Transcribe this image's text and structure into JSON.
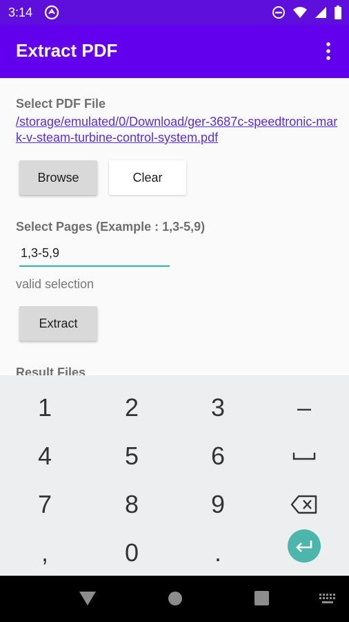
{
  "status_bar": {
    "time": "3:14",
    "icons": [
      "at-sign-icon",
      "do-not-disturb-icon",
      "wifi-icon",
      "signal-icon",
      "battery-icon"
    ]
  },
  "app_bar": {
    "title": "Extract PDF",
    "menu_icon": "overflow-menu-icon"
  },
  "main": {
    "select_file_label": "Select PDF File",
    "file_path": "/storage/emulated/0/Download/ger-3687c-speedtronic-mark-v-steam-turbine-control-system.pdf",
    "browse_label": "Browse",
    "clear_label": "Clear",
    "select_pages_label": "Select Pages (Example : 1,3-5,9)",
    "pages_value": "1,3-5,9",
    "validation_text": "valid selection",
    "extract_label": "Extract",
    "result_label": "Result Files"
  },
  "keyboard": {
    "rows": [
      [
        "1",
        "2",
        "3",
        "–"
      ],
      [
        "4",
        "5",
        "6",
        "space"
      ],
      [
        "7",
        "8",
        "9",
        "backspace"
      ],
      [
        ",",
        "0",
        ".",
        "enter"
      ]
    ]
  },
  "nav_bar": {
    "icons": [
      "back-icon",
      "home-icon",
      "recents-icon",
      "keyboard-switch-icon"
    ]
  },
  "colors": {
    "status_bar": "#5f0fdc",
    "app_bar": "#6200ee",
    "link": "#5a2ed6",
    "accent": "#26b4a5",
    "enter_key": "#4db6ac"
  }
}
